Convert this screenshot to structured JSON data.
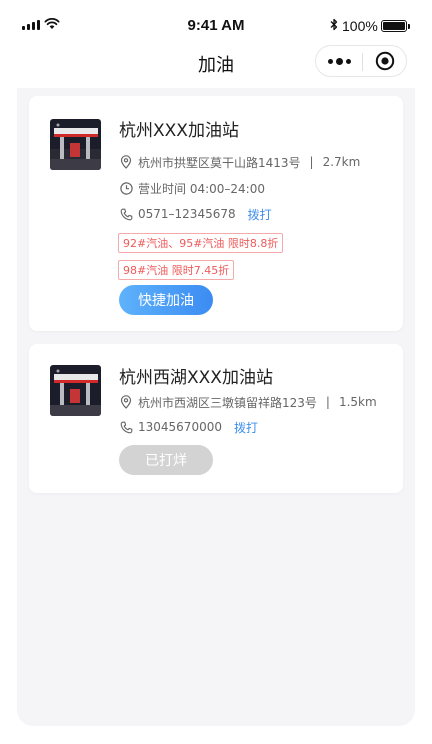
{
  "status_bar": {
    "time": "9:41 AM",
    "battery": "100%"
  },
  "nav": {
    "title": "加油"
  },
  "stations": [
    {
      "name": "杭州XXX加油站",
      "address": "杭州市拱墅区莫干山路1413号",
      "distance": "2.7km",
      "hours": "营业时间 04:00–24:00",
      "phone": "0571–12345678",
      "dial_label": "拨打",
      "tags": [
        "92#汽油、95#汽油 限时8.8折",
        "98#汽油 限时7.45折"
      ],
      "button_label": "快捷加油"
    },
    {
      "name": "杭州西湖XXX加油站",
      "address": "杭州市西湖区三墩镇留祥路123号",
      "distance": "1.5km",
      "phone": "13045670000",
      "dial_label": "拨打",
      "button_label": "已打烊"
    }
  ],
  "colors": {
    "accent": "#3d8ef0",
    "tag_red": "#ee5a5a",
    "disabled": "#d3d3d3"
  }
}
